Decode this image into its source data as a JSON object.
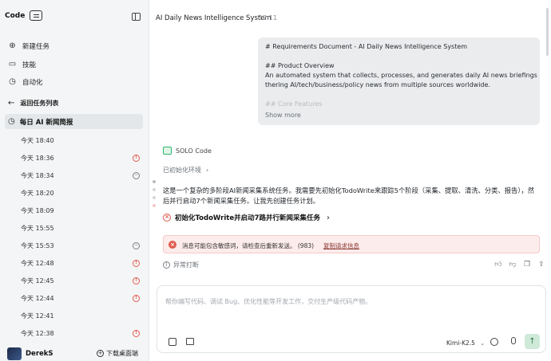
{
  "sidebar": {
    "brand": "Code",
    "nav": [
      {
        "label": "新建任务",
        "icon": "new-task-icon"
      },
      {
        "label": "技能",
        "icon": "book-icon"
      },
      {
        "label": "自动化",
        "icon": "clock-icon"
      }
    ],
    "back_label": "返回任务列表",
    "active_task": "每日 AI 新闻简报",
    "tasks": [
      {
        "label": "今天 18:40",
        "status": ""
      },
      {
        "label": "今天 18:36",
        "status": "error"
      },
      {
        "label": "今天 18:34",
        "status": "paused"
      },
      {
        "label": "今天 18:20",
        "status": ""
      },
      {
        "label": "今天 18:09",
        "status": ""
      },
      {
        "label": "今天 15:55",
        "status": ""
      },
      {
        "label": "今天 15:53",
        "status": "paused"
      },
      {
        "label": "今天 12:48",
        "status": "error"
      },
      {
        "label": "今天 12:45",
        "status": "error"
      },
      {
        "label": "今天 12:44",
        "status": "error"
      },
      {
        "label": "今天 12:41",
        "status": ""
      },
      {
        "label": "今天 12:38",
        "status": "error"
      }
    ],
    "user": "DerekS",
    "download_label": "下载桌面端"
  },
  "header": {
    "title": "AI Daily News Intelligence System",
    "time": "12:11"
  },
  "requirements": {
    "lines": [
      "# Requirements Document - AI Daily News Intelligence System",
      "## Product Overview",
      "An automated system that collects, processes, and generates daily AI news briefings by ga",
      "thering AI/tech/business/policy news from multiple sources worldwide."
    ],
    "faded": "## Core Features",
    "show_more": "Show more"
  },
  "assistant": {
    "name": "SOLO Code",
    "init_label": "已初始化环境",
    "paragraph": "这是一个复杂的多阶段AI新闻采集系统任务。我需要先初始化TodoWrite来跟踪5个阶段（采集、提取、清洗、分类、报告），然后并行启动7个新闻采集任务。让我先创建任务计划。",
    "failed_step": "初始化TodoWrite并启动7路并行新闻采集任务",
    "alert_message": "消息可能包含敏感词，请检查后重新发送。 (983)",
    "alert_link": "复制请求信息",
    "interrupted": "异常打断"
  },
  "composer": {
    "placeholder": "帮你编写代码、调试 Bug、优化性能等开发工作，交付生产级代码产物。",
    "model": "Kimi-K2.5"
  },
  "colors": {
    "error": "#e05b4d",
    "accent": "#2fb36b",
    "active_bg": "#e3e7e9"
  }
}
